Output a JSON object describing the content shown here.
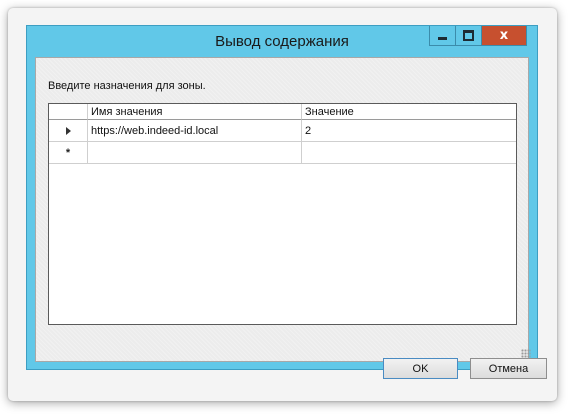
{
  "window": {
    "title": "Вывод содержания",
    "close_glyph": "x"
  },
  "dialog": {
    "prompt": "Введите назначения для зоны."
  },
  "grid": {
    "columns": [
      "Имя значения",
      "Значение"
    ],
    "rows": [
      {
        "name": "https://web.indeed-id.local",
        "value": "2",
        "marker": "current-row-arrow-icon"
      }
    ],
    "new_row_marker": "*"
  },
  "buttons": {
    "ok_label": "OK",
    "cancel_label": "Отмена"
  },
  "colors": {
    "titlebar": "#61c8e8",
    "close_button": "#c7502f"
  }
}
